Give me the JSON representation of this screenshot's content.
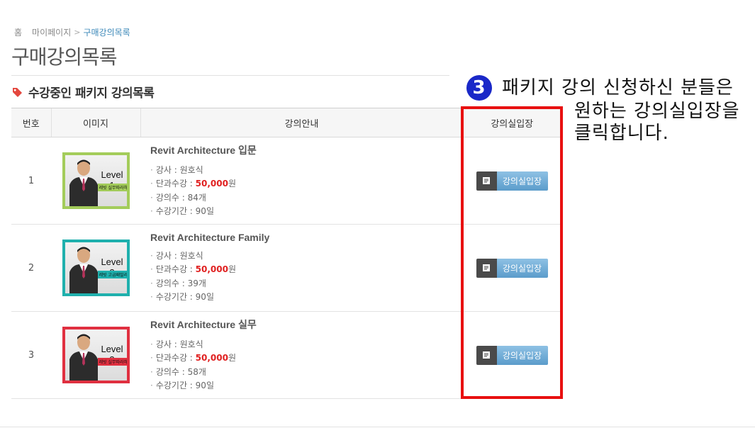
{
  "breadcrumb": {
    "home": "홈",
    "mypage": "마이페이지",
    "sep": ">",
    "current": "구매강의목록"
  },
  "page_title": "구매강의목록",
  "section_title": "수강중인 패키지 강의목록",
  "table": {
    "headers": {
      "num": "번호",
      "image": "이미지",
      "info": "강의안내",
      "enter": "강의실입장"
    },
    "rows": [
      {
        "num": "1",
        "thumb_level": "Level 1",
        "thumb_sub": "레빗 실무따라하기",
        "thumb_color": "#a3cc5a",
        "title": "Revit Architecture 입문",
        "instructor_label": "강사 : ",
        "instructor": "원호식",
        "price_label": "단과수강 : ",
        "price": "50,000",
        "price_unit": "원",
        "count_label": "강의수 : ",
        "count": "84개",
        "period_label": "수강기간 : ",
        "period": "90일",
        "button": "강의실입장"
      },
      {
        "num": "2",
        "thumb_level": "Level 2",
        "thumb_sub": "레빗 고급패밀리",
        "thumb_color": "#1fb0ad",
        "title": "Revit Architecture Family",
        "instructor_label": "강사 : ",
        "instructor": "원호식",
        "price_label": "단과수강 : ",
        "price": "50,000",
        "price_unit": "원",
        "count_label": "강의수 : ",
        "count": "39개",
        "period_label": "수강기간 : ",
        "period": "90일",
        "button": "강의실입장"
      },
      {
        "num": "3",
        "thumb_level": "Level 3",
        "thumb_sub": "레빗 실무따라하기",
        "thumb_color": "#e03040",
        "title": "Revit Architecture 실무",
        "instructor_label": "강사 : ",
        "instructor": "원호식",
        "price_label": "단과수강 : ",
        "price": "50,000",
        "price_unit": "원",
        "count_label": "강의수 : ",
        "count": "58개",
        "period_label": "수강기간 : ",
        "period": "90일",
        "button": "강의실입장"
      }
    ]
  },
  "annotation": {
    "number": "3",
    "line1": "패키지 강의 신청하신 분들은",
    "line2": "원하는 강의실입장을",
    "line3": "클릭합니다."
  },
  "colors": {
    "highlight": "#e81010",
    "badge": "#1a28c8",
    "price": "#e02020",
    "breadcrumb_current": "#3a87b8",
    "button": "#6fa9d6"
  },
  "icons": {
    "section": "tag-icon",
    "button": "document-icon"
  }
}
